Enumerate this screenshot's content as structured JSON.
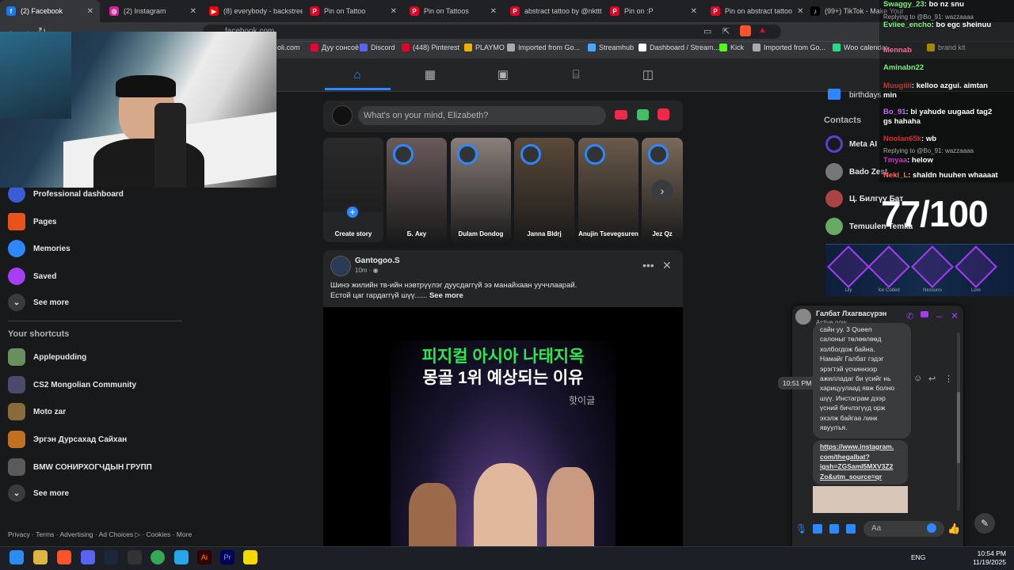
{
  "tabs": [
    {
      "label": "(2) Facebook",
      "color": "#1877f2",
      "glyph": "f"
    },
    {
      "label": "(2) Instagram",
      "color": "#d6249f",
      "glyph": "◎"
    },
    {
      "label": "(8) everybody - backstreet",
      "color": "#ff0000",
      "glyph": "▶"
    },
    {
      "label": "Pin on Tattoo",
      "color": "#e60023",
      "glyph": "P"
    },
    {
      "label": "Pin on Tattoos",
      "color": "#e60023",
      "glyph": "P"
    },
    {
      "label": "abstract tattoo by @nkttt",
      "color": "#e60023",
      "glyph": "P"
    },
    {
      "label": "Pin on :P",
      "color": "#e60023",
      "glyph": "P"
    },
    {
      "label": "Pin on abstract tattoo",
      "color": "#e60023",
      "glyph": "P"
    },
    {
      "label": "(99+) TikTok - Make Your",
      "color": "#000000",
      "glyph": "♪"
    }
  ],
  "url": "facebook.com",
  "bookmarks": [
    "oli.com",
    "Дуу сонсоё",
    "Discord",
    "(448) Pinterest",
    "PLAYMO",
    "Imported from Go...",
    "Streamhub",
    "Dashboard / Stream...",
    "Kick",
    "Imported from Go...",
    "Woo calendar",
    "brand kit"
  ],
  "left_menu": [
    {
      "label": "Professional dashboard",
      "color": "#3b5cd6"
    },
    {
      "label": "Pages",
      "color": "#e9531b"
    },
    {
      "label": "Memories",
      "color": "#2d88ff"
    },
    {
      "label": "Saved",
      "color": "#a73df5"
    }
  ],
  "see_more": "See more",
  "shortcuts_title": "Your shortcuts",
  "shortcuts": [
    {
      "label": "Applepudding",
      "color": "#6a8f5e"
    },
    {
      "label": "CS2 Mongolian Community",
      "color": "#4a4a6a"
    },
    {
      "label": "Moto zar",
      "color": "#8a6a3a"
    },
    {
      "label": "Эргэн Дурсахад Сайхан",
      "color": "#c07020"
    },
    {
      "label": "BMW СОНИРХОГЧДЫН ГРУПП",
      "color": "#5a5a5a"
    }
  ],
  "see_more_2": "See more",
  "footer": "Privacy · Terms · Advertising · Ad Choices ▷ · Cookies · More",
  "composer_placeholder": "What's on your mind, Elizabeth?",
  "stories": [
    {
      "name": "Create story",
      "color": "#2a2a2a"
    },
    {
      "name": "Б. Аку",
      "color": "#6a5a5a"
    },
    {
      "name": "Dulam Dondog",
      "color": "#8a7f7a"
    },
    {
      "name": "Janna Bldrj",
      "color": "#5a4a3a"
    },
    {
      "name": "Anujin Tsevegsuren",
      "color": "#6a5a4a"
    },
    {
      "name": "Jez Qz",
      "color": "#7a6a5a"
    }
  ],
  "post": {
    "author": "Gantogoo.S",
    "time": "10m · ◉",
    "text_line1": "Шинэ жилийн тв-ийн нэвтрүүлэг дуусдаггүй ээ манайхаан ууччлаарай.",
    "text_line2": "Естой цаг гардаггүй шүү......",
    "see_more": "See more",
    "image_title1": "피지컬 아시아 나태지옥",
    "image_title2": "몽골 1위 예상되는 이유",
    "image_brand": "핫이글"
  },
  "birthdays": "birthdays",
  "contacts_title": "Contacts",
  "contacts": [
    {
      "name": "Meta AI",
      "color": "#5b3fd6"
    },
    {
      "name": "Bado Zest",
      "color": "#777"
    },
    {
      "name": "Ц. Билгүү Бат",
      "color": "#a44"
    },
    {
      "name": "Temuulen Temka",
      "color": "#6a6"
    }
  ],
  "stream_chat": [
    {
      "user": "Swaggy_23",
      "msg": "bo nz snu",
      "ucolor": "#7cf07c"
    },
    {
      "reply": "Replying to @Bo_91: wazzaaaa"
    },
    {
      "user": "Eviiee_encho",
      "msg": "bo egc sheinuu",
      "ucolor": "#7cf07c"
    },
    {
      "user": "Mennab",
      "msg": "",
      "ucolor": "#ff6699"
    },
    {
      "user": "Aminabn22",
      "msg": "",
      "ucolor": "#7cf07c"
    },
    {
      "user": "Muugiiii",
      "msg": "kelloo azgui. aimtan min",
      "ucolor": "#cc3333"
    },
    {
      "user": "Bo_91",
      "msg": "bi yahude uugaad tag2 gs hahaha",
      "ucolor": "#cc66ff"
    },
    {
      "user": "Noolan65k",
      "msg": "wb",
      "ucolor": "#cc3333"
    },
    {
      "reply": "Replying to @Bo_91: wazzaaaa"
    },
    {
      "user": "Tmyaa",
      "msg": "helow",
      "ucolor": "#cc33cc"
    },
    {
      "user": "Nekl_L",
      "msg": "shaldn huuhen whaaaat",
      "ucolor": "#ff6666"
    }
  ],
  "score": "77/100",
  "weapon_labels": [
    "Lily",
    "Ice Coded",
    "Nessuno",
    "Lore"
  ],
  "messenger": {
    "name": "Галбат Лхагвасүрэн",
    "status": "Active now",
    "msg_lines": [
      "сайн уу. 3 Queen",
      "салоныг төлөөлөөд",
      "холбогдож байна.",
      "Намайг Галбат гэдэг",
      "эрэгтэй үсчиннээр",
      "ажилладаг би үсийг нь",
      "харицуулаад явж болно",
      "шүү. Инстаграм дээр",
      "үсний бичлэгүүд орж",
      "эхэлж байгаа линк",
      "явуулъя."
    ],
    "time": "10:51 PM",
    "link_lines": [
      "https://www.instagram.",
      "com/thegalbat?",
      "igsh=ZGSamI5MXV3Z2",
      "Zo&utm_source=qr"
    ],
    "input_placeholder": "Aa"
  },
  "taskbar": {
    "lang": "ENG",
    "time": "10:54 PM",
    "date": "11/19/2025"
  }
}
